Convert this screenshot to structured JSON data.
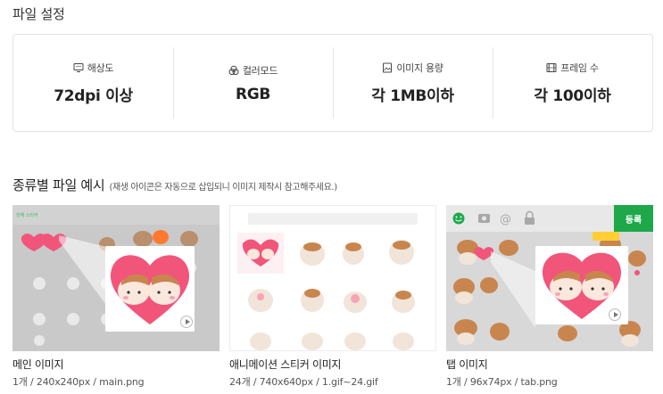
{
  "section": {
    "title": "파일 설정"
  },
  "specs": [
    {
      "icon": "monitor-icon",
      "label": "해상도",
      "value": "72dpi 이상"
    },
    {
      "icon": "color-mode-icon",
      "label": "컬러모드",
      "value": "RGB"
    },
    {
      "icon": "image-file-icon",
      "label": "이미지 용량",
      "value": "각 1MB이하"
    },
    {
      "icon": "film-frame-icon",
      "label": "프레임 수",
      "value": "각 100이하"
    }
  ],
  "examples": {
    "title": "종류별 파일 예시",
    "note": "(재생 아이콘은 자동으로 삽입되니 이미지 제작시 참고해주세요.)",
    "cards": [
      {
        "name": "메인 이미지",
        "meta": "1개 / 240x240px / main.png",
        "header_text": "전체 스티커"
      },
      {
        "name": "애니메이션 스티커 이미지",
        "meta": "24개 / 740x640px / 1.gif~24.gif"
      },
      {
        "name": "탭 이미지",
        "meta": "1개 / 96x74px / tab.png",
        "button_label": "등록"
      }
    ]
  },
  "colors": {
    "accent_green": "#1ea84a",
    "heart_pink": "#f2557a",
    "spec_border": "#e3e3e3"
  }
}
